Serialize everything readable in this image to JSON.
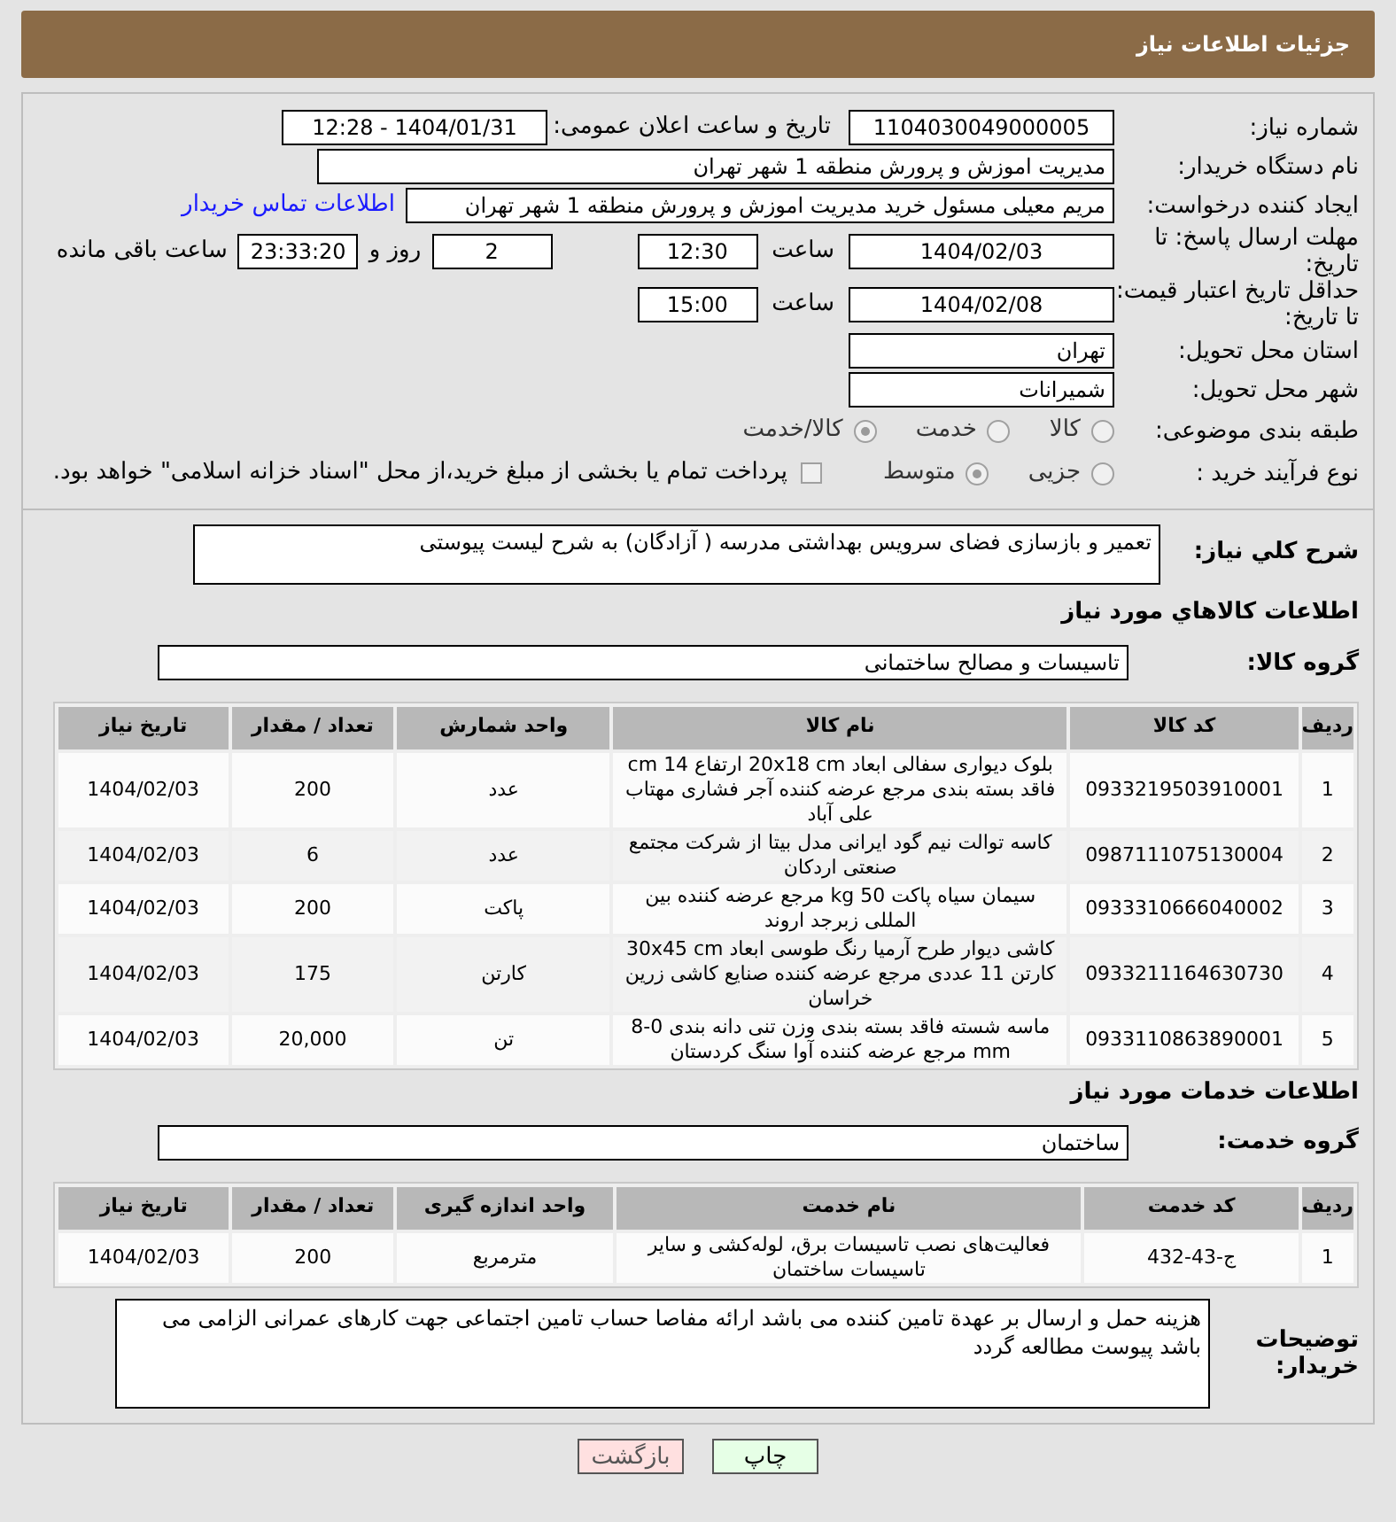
{
  "header": {
    "title": "جزئیات اطلاعات نیاز"
  },
  "need_number": {
    "label": "شماره نیاز:",
    "value": "1104030049000005"
  },
  "announce": {
    "label": "تاریخ و ساعت اعلان عمومی:",
    "value": "1404/01/31 - 12:28"
  },
  "buyer": {
    "label": "نام دستگاه خریدار:",
    "value": "مدیریت اموزش و پرورش منطقه 1 شهر تهران"
  },
  "requester": {
    "label": "ایجاد کننده درخواست:",
    "value": "مریم معیلی مسئول خرید  مدیریت اموزش و پرورش منطقه 1 شهر تهران",
    "link": "اطلاعات تماس خریدار"
  },
  "deadline": {
    "label": "مهلت ارسال پاسخ: تا تاریخ:",
    "date": "1404/02/03",
    "time_label": "ساعت",
    "time": "12:30",
    "days": "2",
    "days_label": "روز و",
    "remaining": "23:33:20",
    "remaining_label": "ساعت باقی مانده"
  },
  "validity": {
    "label": "حداقل تاریخ اعتبار قیمت: تا تاریخ:",
    "date": "1404/02/08",
    "time_label": "ساعت",
    "time": "15:00"
  },
  "province": {
    "label": "استان محل تحویل:",
    "value": "تهران"
  },
  "city": {
    "label": "شهر محل تحویل:",
    "value": "شمیرانات"
  },
  "category": {
    "label": "طبقه بندی موضوعی:",
    "options": [
      {
        "label": "کالا",
        "selected": false
      },
      {
        "label": "خدمت",
        "selected": false
      },
      {
        "label": "کالا/خدمت",
        "selected": true
      }
    ]
  },
  "process": {
    "label": "نوع فرآیند خرید :",
    "options": [
      {
        "label": "جزیی",
        "selected": false
      },
      {
        "label": "متوسط",
        "selected": true
      }
    ],
    "payment_checked": false,
    "payment_note": "پرداخت تمام یا بخشی از مبلغ خرید،از محل \"اسناد خزانه اسلامی\" خواهد بود."
  },
  "description": {
    "label": "شرح کلي نياز:",
    "value": "تعمیر و بازسازی فضای سرویس بهداشتی مدرسه ( آزادگان) به شرح لیست پیوستی"
  },
  "goods": {
    "heading": "اطلاعات کالاهاي مورد نياز",
    "group_label": "گروه کالا:",
    "group": "تاسیسات و مصالح ساختمانی",
    "columns": [
      "ردیف",
      "کد کالا",
      "نام کالا",
      "واحد شمارش",
      "تعداد / مقدار",
      "تاریخ نیاز"
    ],
    "rows": [
      [
        "1",
        "0933219503910001",
        "بلوک دیواری سفالی ابعاد 20x18 cm ارتفاع 14 cm فاقد بسته بندی مرجع عرضه کننده آجر فشاری مهتاب علی آباد",
        "عدد",
        "200",
        "1404/02/03"
      ],
      [
        "2",
        "0987111075130004",
        "کاسه توالت نیم گود ایرانی مدل بیتا از شرکت مجتمع صنعتی اردکان",
        "عدد",
        "6",
        "1404/02/03"
      ],
      [
        "3",
        "0933310666040002",
        "سیمان سیاه پاکت 50 kg مرجع عرضه کننده بین المللی زبرجد اروند",
        "پاکت",
        "200",
        "1404/02/03"
      ],
      [
        "4",
        "0933211164630730",
        "کاشی دیوار طرح آرمیا رنگ طوسی ابعاد 30x45 cm کارتن 11 عددی مرجع عرضه کننده صنایع کاشی زرین خراسان",
        "کارتن",
        "175",
        "1404/02/03"
      ],
      [
        "5",
        "0933110863890001",
        "ماسه شسته فاقد بسته بندی وزن تنی دانه بندی 0-8 mm مرجع عرضه کننده آوا سنگ کردستان",
        "تن",
        "20,000",
        "1404/02/03"
      ]
    ]
  },
  "services": {
    "heading": "اطلاعات خدمات مورد نياز",
    "group_label": "گروه خدمت:",
    "group": "ساختمان",
    "columns": [
      "ردیف",
      "کد خدمت",
      "نام خدمت",
      "واحد اندازه گیری",
      "تعداد / مقدار",
      "تاریخ نیاز"
    ],
    "rows": [
      [
        "1",
        "ج-43-432",
        "فعالیت‌های نصب تاسیسات برق، لوله‌کشی و سایر تاسیسات ساختمان",
        "مترمربع",
        "200",
        "1404/02/03"
      ]
    ]
  },
  "notes": {
    "label": "توضیحات خریدار:",
    "value": "هزینه حمل و ارسال بر عهدة تامین کننده می باشد ارائه مفاصا حساب تامین اجتماعی جهت کارهای عمرانی الزامی می باشد پیوست مطالعه گردد"
  },
  "buttons": [
    {
      "label": "چاپ",
      "kind": "print"
    },
    {
      "label": "بازگشت",
      "kind": "back"
    }
  ]
}
